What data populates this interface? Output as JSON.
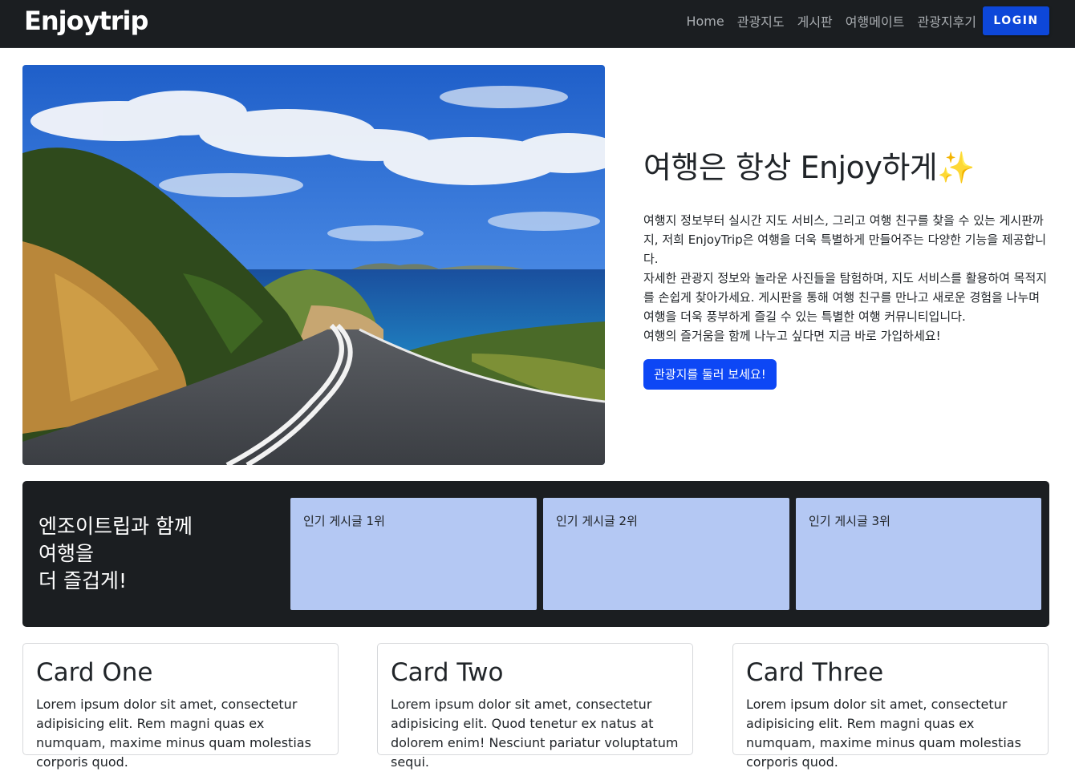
{
  "navbar": {
    "brand": "Enjoytrip",
    "links": [
      "Home",
      "관광지도",
      "게시판",
      "여행메이트",
      "관광지후기"
    ],
    "login_label": "LOGIN"
  },
  "hero": {
    "image_alt": "coastal-road-photo",
    "title": "여행은 항상 Enjoy하게",
    "title_emoji": "✨",
    "paragraphs": [
      "여행지 정보부터 실시간 지도 서비스, 그리고 여행 친구를 찾을 수 있는 게시판까지, 저희 EnjoyTrip은 여행을 더욱 특별하게 만들어주는 다양한 기능을 제공합니다.",
      "자세한 관광지 정보와 놀라운 사진들을 탐험하며, 지도 서비스를 활용하여 목적지를 손쉽게 찾아가세요. 게시판을 통해 여행 친구를 만나고 새로운 경험을 나누며 여행을 더욱 풍부하게 즐길 수 있는 특별한 여행 커뮤니티입니다.",
      "여행의 즐거움을 함께 나누고 싶다면 지금 바로 가입하세요!"
    ],
    "cta_label": "관광지를 둘러 보세요!"
  },
  "popular": {
    "title_lines": [
      "엔조이트립과 함께",
      "여행을",
      "더 즐겁게!"
    ],
    "cards": [
      "인기 게시글 1위",
      "인기 게시글 2위",
      "인기 게시글 3위"
    ]
  },
  "cards": [
    {
      "title": "Card One",
      "text": "Lorem ipsum dolor sit amet, consectetur adipisicing elit. Rem magni quas ex numquam, maxime minus quam molestias corporis quod."
    },
    {
      "title": "Card Two",
      "text": "Lorem ipsum dolor sit amet, consectetur adipisicing elit. Quod tenetur ex natus at dolorem enim! Nesciunt pariatur voluptatum sequi."
    },
    {
      "title": "Card Three",
      "text": "Lorem ipsum dolor sit amet, consectetur adipisicing elit. Rem magni quas ex numquam, maxime minus quam molestias corporis quod."
    }
  ],
  "colors": {
    "navbar_bg": "#1b1e21",
    "login_bg": "#0d47d9",
    "cta_bg": "#0d47f5",
    "popular_card_bg": "#b4c8f3"
  }
}
